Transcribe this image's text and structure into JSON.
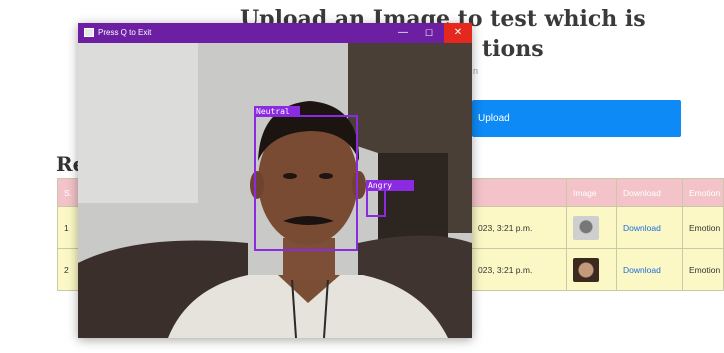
{
  "background_page": {
    "heading_line1": "Upload an Image to test which is",
    "heading_line2": "tions",
    "subtext": "n",
    "upload_button": "Upload",
    "recent_heading": "Re",
    "table": {
      "headers": [
        "S.",
        "",
        "",
        "Image",
        "Download",
        "Emotion"
      ],
      "rows": [
        {
          "sno": "1",
          "date": "023, 3:21 p.m.",
          "download": "Download",
          "emotion": "Emotion"
        },
        {
          "sno": "2",
          "date": "023, 3:21 p.m.",
          "download": "Download",
          "emotion": "Emotion"
        }
      ]
    }
  },
  "camera_window": {
    "title": "Press Q to Exit",
    "minimize_glyph": "—",
    "maximize_glyph": "☐",
    "close_glyph": "✕",
    "detections": [
      {
        "label": "Neutral"
      },
      {
        "label": "Angry"
      }
    ],
    "box_color": "#8a2be2",
    "titlebar_color": "#6c1fa3"
  },
  "colors": {
    "upload_button": "#0d8af6",
    "table_header": "#f3c3c9",
    "table_row": "#fbf8c5",
    "close_button": "#e5281e"
  }
}
